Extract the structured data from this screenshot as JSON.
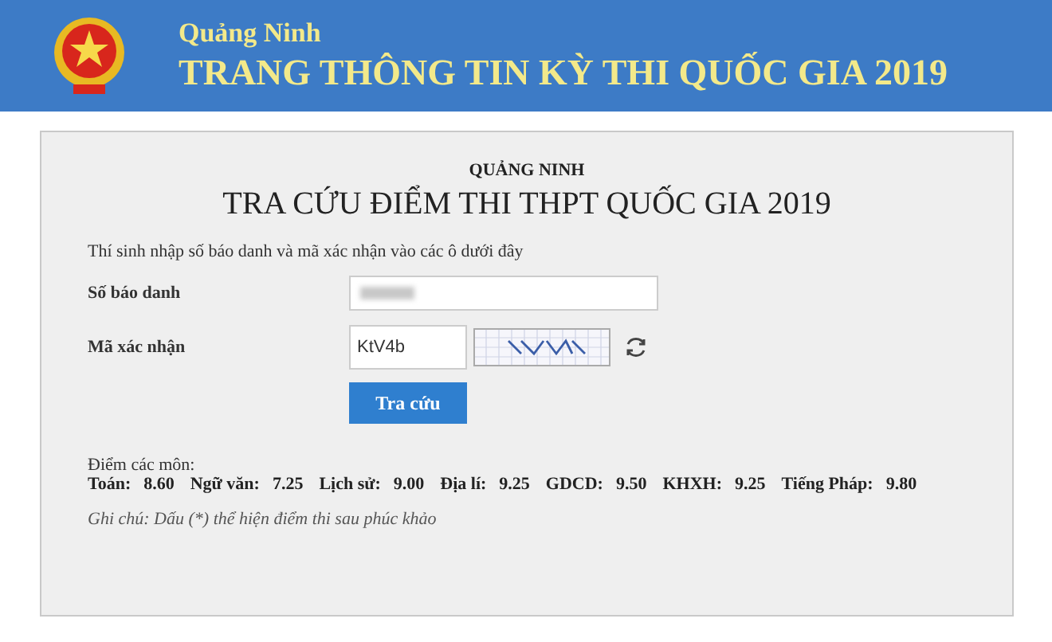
{
  "header": {
    "province": "Quảng Ninh",
    "title": "TRANG THÔNG TIN KỲ THI QUỐC GIA 2019"
  },
  "panel": {
    "subtitle": "QUẢNG NINH",
    "title": "TRA CỨU ĐIỂM THI THPT QUỐC GIA 2019",
    "instruction": "Thí sinh nhập số báo danh và mã xác nhận vào các ô dưới đây",
    "fields": [
      {
        "kind": "id",
        "label": "Số báo danh"
      },
      {
        "kind": "captcha",
        "label": "Mã xác nhận",
        "value": "KtV4b"
      }
    ],
    "submit": "Tra cứu",
    "scores_heading": "Điểm các môn:",
    "scores": [
      {
        "subject": "Toán:",
        "score": "8.60"
      },
      {
        "subject": "Ngữ văn:",
        "score": "7.25"
      },
      {
        "subject": "Lịch sử:",
        "score": "9.00"
      },
      {
        "subject": "Địa lí:",
        "score": "9.25"
      },
      {
        "subject": "GDCD:",
        "score": "9.50"
      },
      {
        "subject": "KHXH:",
        "score": "9.25"
      },
      {
        "subject": "Tiếng Pháp:",
        "score": "9.80"
      }
    ],
    "note": "Ghi chú: Dấu (*) thể hiện điểm thi sau phúc khảo"
  }
}
